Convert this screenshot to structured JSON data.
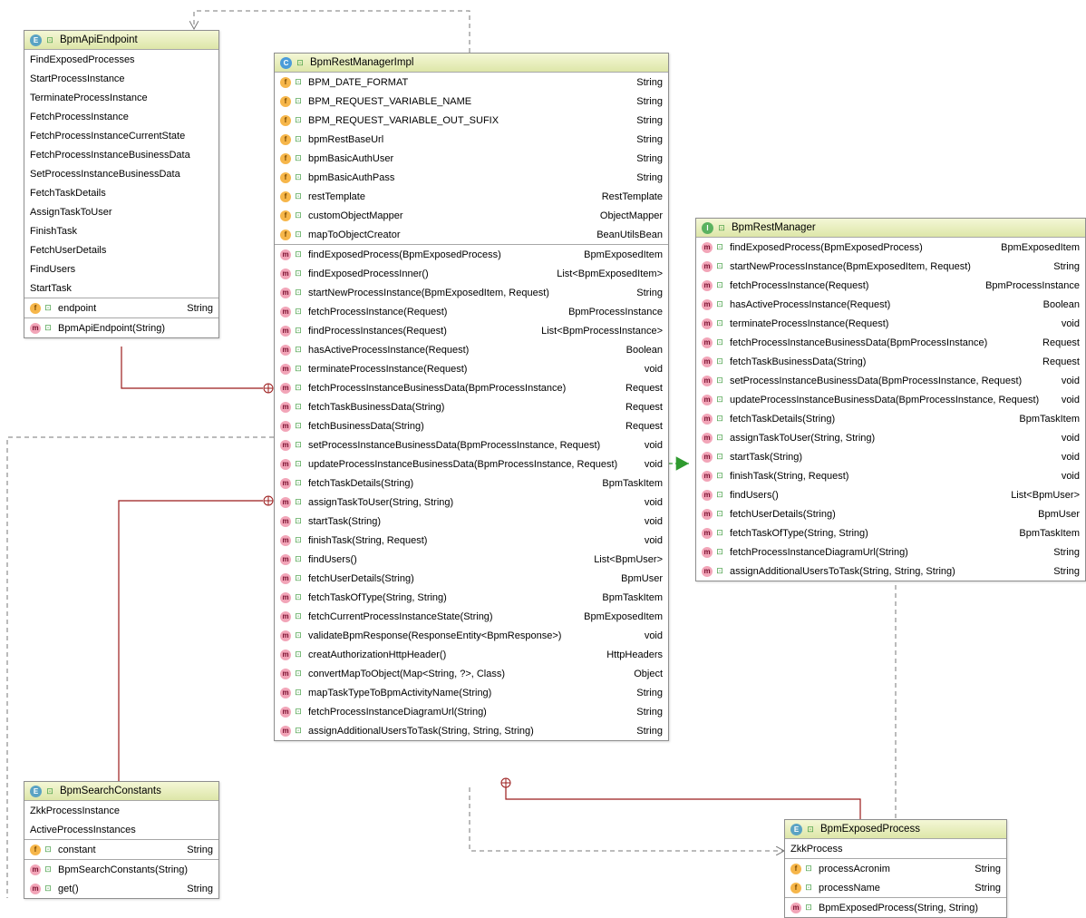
{
  "classes": {
    "endpoint": {
      "kind": "E",
      "name": "BpmApiEndpoint",
      "constants": [
        "FindExposedProcesses",
        "StartProcessInstance",
        "TerminateProcessInstance",
        "FetchProcessInstance",
        "FetchProcessInstanceCurrentState",
        "FetchProcessInstanceBusinessData",
        "SetProcessInstanceBusinessData",
        "FetchTaskDetails",
        "AssignTaskToUser",
        "FinishTask",
        "FetchUserDetails",
        "FindUsers",
        "StartTask"
      ],
      "fields": [
        {
          "name": "endpoint",
          "type": "String"
        }
      ],
      "methods": [
        {
          "name": "BpmApiEndpoint(String)",
          "type": ""
        }
      ]
    },
    "impl": {
      "kind": "C",
      "name": "BpmRestManagerImpl",
      "fields": [
        {
          "name": "BPM_DATE_FORMAT",
          "type": "String"
        },
        {
          "name": "BPM_REQUEST_VARIABLE_NAME",
          "type": "String"
        },
        {
          "name": "BPM_REQUEST_VARIABLE_OUT_SUFIX",
          "type": "String"
        },
        {
          "name": "bpmRestBaseUrl",
          "type": "String"
        },
        {
          "name": "bpmBasicAuthUser",
          "type": "String"
        },
        {
          "name": "bpmBasicAuthPass",
          "type": "String"
        },
        {
          "name": "restTemplate",
          "type": "RestTemplate"
        },
        {
          "name": "customObjectMapper",
          "type": "ObjectMapper"
        },
        {
          "name": "mapToObjectCreator",
          "type": "BeanUtilsBean"
        }
      ],
      "methods": [
        {
          "name": "findExposedProcess(BpmExposedProcess)",
          "type": "BpmExposedItem"
        },
        {
          "name": "findExposedProcessInner()",
          "type": "List<BpmExposedItem>"
        },
        {
          "name": "startNewProcessInstance(BpmExposedItem, Request)",
          "type": "String"
        },
        {
          "name": "fetchProcessInstance(Request)",
          "type": "BpmProcessInstance"
        },
        {
          "name": "findProcessInstances(Request)",
          "type": "List<BpmProcessInstance>"
        },
        {
          "name": "hasActiveProcessInstance(Request)",
          "type": "Boolean"
        },
        {
          "name": "terminateProcessInstance(Request)",
          "type": "void"
        },
        {
          "name": "fetchProcessInstanceBusinessData(BpmProcessInstance)",
          "type": "Request"
        },
        {
          "name": "fetchTaskBusinessData(String)",
          "type": "Request"
        },
        {
          "name": "fetchBusinessData(String)",
          "type": "Request"
        },
        {
          "name": "setProcessInstanceBusinessData(BpmProcessInstance, Request)",
          "type": "void"
        },
        {
          "name": "updateProcessInstanceBusinessData(BpmProcessInstance, Request)",
          "type": "void"
        },
        {
          "name": "fetchTaskDetails(String)",
          "type": "BpmTaskItem"
        },
        {
          "name": "assignTaskToUser(String, String)",
          "type": "void"
        },
        {
          "name": "startTask(String)",
          "type": "void"
        },
        {
          "name": "finishTask(String, Request)",
          "type": "void"
        },
        {
          "name": "findUsers()",
          "type": "List<BpmUser>"
        },
        {
          "name": "fetchUserDetails(String)",
          "type": "BpmUser"
        },
        {
          "name": "fetchTaskOfType(String, String)",
          "type": "BpmTaskItem"
        },
        {
          "name": "fetchCurrentProcessInstanceState(String)",
          "type": "BpmExposedItem"
        },
        {
          "name": "validateBpmResponse(ResponseEntity<BpmResponse>)",
          "type": "void"
        },
        {
          "name": "creatAuthorizationHttpHeader()",
          "type": "HttpHeaders"
        },
        {
          "name": "convertMapToObject(Map<String, ?>, Class)",
          "type": "Object"
        },
        {
          "name": "mapTaskTypeToBpmActivityName(String)",
          "type": "String"
        },
        {
          "name": "fetchProcessInstanceDiagramUrl(String)",
          "type": "String"
        },
        {
          "name": "assignAdditionalUsersToTask(String, String, String)",
          "type": "String"
        }
      ]
    },
    "manager": {
      "kind": "I",
      "name": "BpmRestManager",
      "methods": [
        {
          "name": "findExposedProcess(BpmExposedProcess)",
          "type": "BpmExposedItem"
        },
        {
          "name": "startNewProcessInstance(BpmExposedItem, Request)",
          "type": "String"
        },
        {
          "name": "fetchProcessInstance(Request)",
          "type": "BpmProcessInstance"
        },
        {
          "name": "hasActiveProcessInstance(Request)",
          "type": "Boolean"
        },
        {
          "name": "terminateProcessInstance(Request)",
          "type": "void"
        },
        {
          "name": "fetchProcessInstanceBusinessData(BpmProcessInstance)",
          "type": "Request"
        },
        {
          "name": "fetchTaskBusinessData(String)",
          "type": "Request"
        },
        {
          "name": "setProcessInstanceBusinessData(BpmProcessInstance, Request)",
          "type": "void"
        },
        {
          "name": "updateProcessInstanceBusinessData(BpmProcessInstance, Request)",
          "type": "void"
        },
        {
          "name": "fetchTaskDetails(String)",
          "type": "BpmTaskItem"
        },
        {
          "name": "assignTaskToUser(String, String)",
          "type": "void"
        },
        {
          "name": "startTask(String)",
          "type": "void"
        },
        {
          "name": "finishTask(String, Request)",
          "type": "void"
        },
        {
          "name": "findUsers()",
          "type": "List<BpmUser>"
        },
        {
          "name": "fetchUserDetails(String)",
          "type": "BpmUser"
        },
        {
          "name": "fetchTaskOfType(String, String)",
          "type": "BpmTaskItem"
        },
        {
          "name": "fetchProcessInstanceDiagramUrl(String)",
          "type": "String"
        },
        {
          "name": "assignAdditionalUsersToTask(String, String, String)",
          "type": "String"
        }
      ]
    },
    "search": {
      "kind": "E",
      "name": "BpmSearchConstants",
      "constants": [
        "ZkkProcessInstance",
        "ActiveProcessInstances"
      ],
      "fields": [
        {
          "name": "constant",
          "type": "String"
        }
      ],
      "methods": [
        {
          "name": "BpmSearchConstants(String)",
          "type": ""
        },
        {
          "name": "get()",
          "type": "String"
        }
      ]
    },
    "exposed": {
      "kind": "E",
      "name": "BpmExposedProcess",
      "constants": [
        "ZkkProcess"
      ],
      "fields": [
        {
          "name": "processAcronim",
          "type": "String"
        },
        {
          "name": "processName",
          "type": "String"
        }
      ],
      "methods": [
        {
          "name": "BpmExposedProcess(String, String)",
          "type": ""
        }
      ]
    }
  },
  "colors": {
    "header_bg": "#dde6a8",
    "inner_class_link": "#9b1b1b",
    "dependency": "#777777",
    "realization": "#2e9a2e"
  }
}
